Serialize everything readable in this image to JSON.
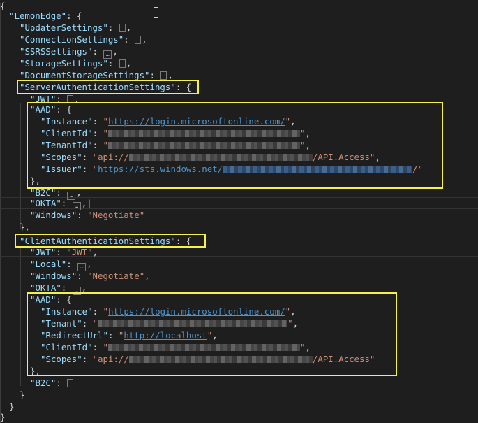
{
  "keys": {
    "root": "LemonEdge",
    "updater": "UpdaterSettings",
    "connection": "ConnectionSettings",
    "ssrs": "SSRSSettings",
    "storage": "StorageSettings",
    "docstorage": "DocumentStorageSettings",
    "serverauth": "ServerAuthenticationSettings",
    "jwt": "JWT",
    "aad": "AAD",
    "instance": "Instance",
    "clientid": "ClientId",
    "tenantid": "TenantId",
    "scopes": "Scopes",
    "issuer": "Issuer",
    "b2c": "B2C",
    "okta": "OKTA",
    "windows": "Windows",
    "clientauth": "ClientAuthenticationSettings",
    "local": "Local",
    "tenant": "Tenant",
    "redirect": "RedirectUrl"
  },
  "values": {
    "instance_url": "https://login.microsoftonline.com/",
    "scopes_prefix": "api://",
    "scopes_suffix": "/API.Access",
    "issuer_url": "https://sts.windows.net/",
    "windows_value": "Negotiate",
    "jwt_value": "JWT",
    "redirect_url": "http://localhost"
  },
  "colors": {
    "background": "#1e1e1e",
    "key": "#9cdcfe",
    "string": "#ce9178",
    "link": "#4e94ce",
    "highlight": "#f5f04a"
  }
}
